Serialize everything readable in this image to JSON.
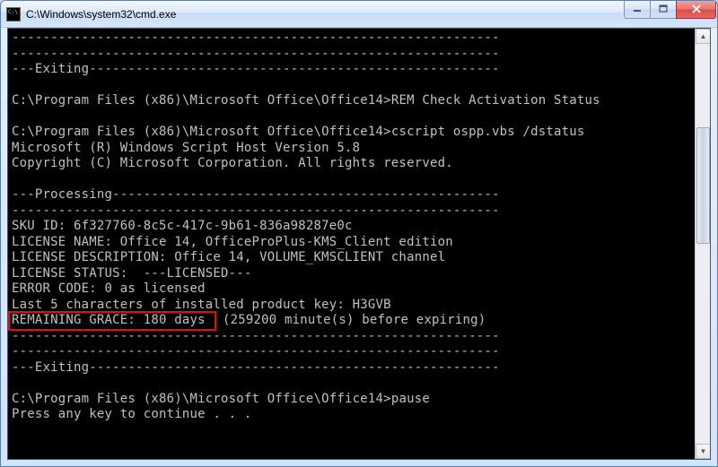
{
  "window": {
    "title": "C:\\Windows\\system32\\cmd.exe"
  },
  "console": {
    "sep1": "---------------------------------------------------------------",
    "exiting": "---Exiting-----------------------------------------------------",
    "prompt1_path": "C:\\Program Files (x86)\\Microsoft Office\\Office14>",
    "prompt1_cmd": "REM Check Activation Status",
    "prompt2_path": "C:\\Program Files (x86)\\Microsoft Office\\Office14>",
    "prompt2_cmd": "cscript ospp.vbs /dstatus",
    "wsh_ver": "Microsoft (R) Windows Script Host Version 5.8",
    "copyright": "Copyright (C) Microsoft Corporation. All rights reserved.",
    "processing": "---Processing--------------------------------------------------",
    "sep2": "---------------------------------------------------------------",
    "sku": "SKU ID: 6f327760-8c5c-417c-9b61-836a98287e0c",
    "licname": "LICENSE NAME: Office 14, OfficeProPlus-KMS_Client edition",
    "licdesc": "LICENSE DESCRIPTION: Office 14, VOLUME_KMSCLIENT channel",
    "licstat": "LICENSE STATUS:  ---LICENSED---",
    "errcode": "ERROR CODE: 0 as licensed",
    "last5": "Last 5 characters of installed product key: H3GVB",
    "grace_highlight": "REMAINING GRACE: 180 days ",
    "grace_rest": " (259200 minute(s) before expiring)",
    "sep3": "---------------------------------------------------------------",
    "sep4": "---------------------------------------------------------------",
    "exiting2": "---Exiting-----------------------------------------------------",
    "prompt3_path": "C:\\Program Files (x86)\\Microsoft Office\\Office14>",
    "prompt3_cmd": "pause",
    "pressany": "Press any key to continue . . ."
  }
}
